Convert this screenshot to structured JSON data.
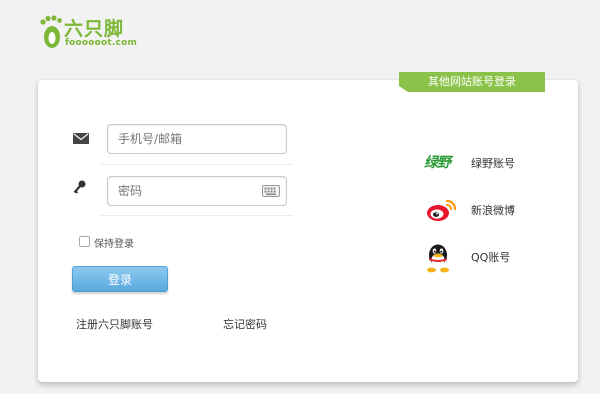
{
  "logo": {
    "name": "六只脚",
    "domain": "foooooot.com"
  },
  "other_login_tag": "其他网站账号登录",
  "form": {
    "account_placeholder": "手机号/邮箱",
    "password_placeholder": "密码",
    "remember_label": "保持登录",
    "login_button": "登录",
    "register_link": "注册六只脚账号",
    "forgot_link": "忘记密码"
  },
  "third_party": [
    {
      "label": "绿野账号",
      "icon": "lvye-icon",
      "icon_text": "绿野"
    },
    {
      "label": "新浪微博",
      "icon": "weibo-icon"
    },
    {
      "label": "QQ账号",
      "icon": "qq-icon"
    }
  ],
  "colors": {
    "brand_green": "#7cb735",
    "tag_green": "#8bc34a",
    "button_blue": "#5aaade"
  }
}
